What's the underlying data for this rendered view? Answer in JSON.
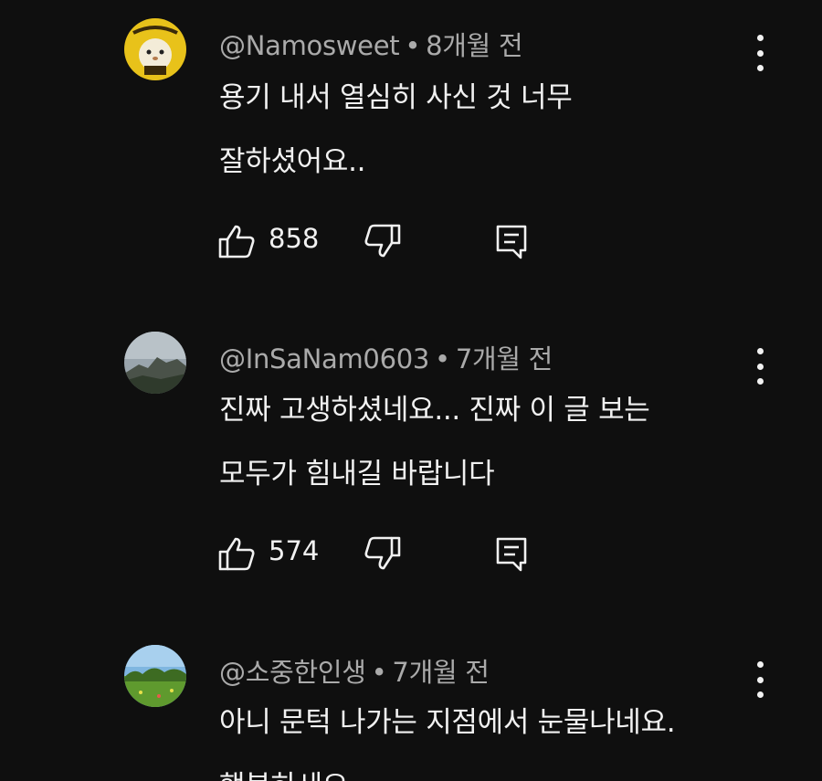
{
  "comments": [
    {
      "author": "@Namosweet",
      "separator": "•",
      "time": "8개월 전",
      "text_lines": [
        "용기 내서 열심히 사신 것 너무",
        "잘하셨어요.."
      ],
      "likes": "858",
      "avatar_icon": "hamster-avatar"
    },
    {
      "author": "@InSaNam0603",
      "separator": "•",
      "time": "7개월 전",
      "text_lines": [
        "진짜 고생하셨네요... 진짜 이 글 보는",
        "모두가 힘내길 바랍니다"
      ],
      "likes": "574",
      "avatar_icon": "mountain-avatar"
    },
    {
      "author": "@소중한인생",
      "separator": "•",
      "time": "7개월 전",
      "text_lines": [
        "아니 문턱 나가는 지점에서 눈물나네요.",
        "행복하세요"
      ],
      "avatar_icon": "meadow-avatar"
    }
  ],
  "colors": {
    "background": "#0f0f0f",
    "text": "#f1f1f1",
    "meta": "#aaaaaa"
  }
}
